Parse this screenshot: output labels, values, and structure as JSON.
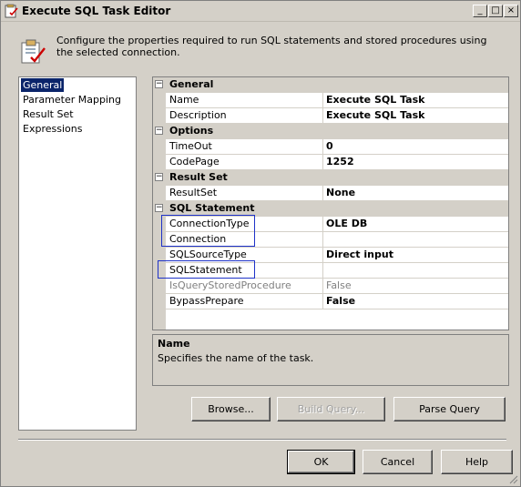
{
  "window": {
    "title": "Execute SQL Task Editor",
    "minimize_glyph": "_",
    "maximize_glyph": "□",
    "close_glyph": "×"
  },
  "header": {
    "description": "Configure the properties required to run SQL statements and stored procedures using the selected connection.",
    "icon": "task-editor-icon"
  },
  "nav": {
    "items": [
      {
        "label": "General",
        "selected": true
      },
      {
        "label": "Parameter Mapping",
        "selected": false
      },
      {
        "label": "Result Set",
        "selected": false
      },
      {
        "label": "Expressions",
        "selected": false
      }
    ]
  },
  "grid": {
    "categories": [
      {
        "label": "General",
        "toggle": "⊟",
        "properties": [
          {
            "name": "Name",
            "value": "Execute SQL Task"
          },
          {
            "name": "Description",
            "value": "Execute SQL Task"
          }
        ]
      },
      {
        "label": "Options",
        "toggle": "⊟",
        "properties": [
          {
            "name": "TimeOut",
            "value": "0"
          },
          {
            "name": "CodePage",
            "value": "1252"
          }
        ]
      },
      {
        "label": "Result Set",
        "toggle": "⊟",
        "properties": [
          {
            "name": "ResultSet",
            "value": "None"
          }
        ]
      },
      {
        "label": "SQL Statement",
        "toggle": "⊟",
        "properties": [
          {
            "name": "ConnectionType",
            "value": "OLE DB"
          },
          {
            "name": "Connection",
            "value": ""
          },
          {
            "name": "SQLSourceType",
            "value": "Direct input"
          },
          {
            "name": "SQLStatement",
            "value": ""
          },
          {
            "name": "IsQueryStoredProcedure",
            "value": "False",
            "disabled": true
          },
          {
            "name": "BypassPrepare",
            "value": "False"
          }
        ]
      }
    ]
  },
  "description_panel": {
    "title": "Name",
    "text": "Specifies the name of the task."
  },
  "buttons": {
    "browse": "Browse...",
    "build_query": "Build Query...",
    "parse_query": "Parse Query",
    "ok": "OK",
    "cancel": "Cancel",
    "help": "Help"
  },
  "colors": {
    "selection": "#0a246a",
    "highlight_box": "#1e32c8",
    "chrome": "#d4d0c8"
  }
}
